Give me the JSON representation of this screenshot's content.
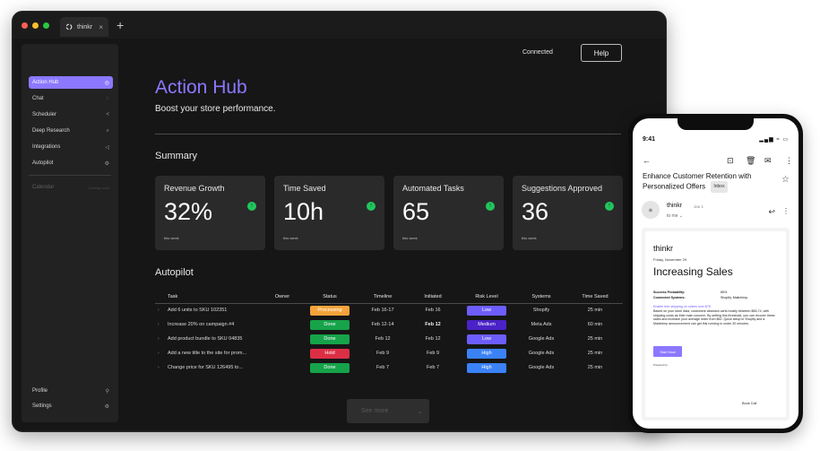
{
  "window": {
    "tab_title": "thinkr",
    "tab_close": "×",
    "new_tab": "+",
    "traffic_colors": [
      "#ff5f57",
      "#febc2e",
      "#28c840"
    ]
  },
  "sidebar": {
    "items": [
      {
        "label": "Action Hub",
        "icon": "target-icon",
        "glyph": "◎"
      },
      {
        "label": "Chat",
        "icon": "chat-icon",
        "glyph": "◌"
      },
      {
        "label": "Scheduler",
        "icon": "share-icon",
        "glyph": "<"
      },
      {
        "label": "Deep Research",
        "icon": "search-icon",
        "glyph": "⌕"
      },
      {
        "label": "Integrations",
        "icon": "megaphone-icon",
        "glyph": "◁"
      },
      {
        "label": "Autopilot",
        "icon": "settings-icon",
        "glyph": "⚙"
      }
    ],
    "calendar": {
      "label": "Calendar",
      "badge": "Coming soon"
    },
    "bottom": [
      {
        "label": "Profile",
        "icon": "user-icon",
        "glyph": "⚲"
      },
      {
        "label": "Settings",
        "icon": "gear-icon",
        "glyph": "⚙"
      }
    ]
  },
  "header": {
    "status": "Connected",
    "help_label": "Help"
  },
  "page": {
    "title": "Action Hub",
    "subtitle": "Boost your store performance."
  },
  "summary": {
    "title": "Summary",
    "cards": [
      {
        "title": "Revenue Growth",
        "value": "32%",
        "caption": "this week"
      },
      {
        "title": "Time Saved",
        "value": "10h",
        "caption": "this week"
      },
      {
        "title": "Automated Tasks",
        "value": "65",
        "caption": "this week"
      },
      {
        "title": "Suggestions Approved",
        "value": "36",
        "caption": "this week"
      }
    ]
  },
  "autopilot": {
    "title": "Autopilot",
    "columns": [
      "Task",
      "Owner",
      "Status",
      "Timeline",
      "Initiated",
      "Risk Level",
      "Systems",
      "Time Saved"
    ],
    "rows": [
      {
        "task": "Add 6 units to SKU 102351",
        "owner": "",
        "status": "Processing",
        "status_color": "#f5a33a",
        "timeline": "Feb 16-17",
        "initiated": "Feb 16",
        "initiated_bold": false,
        "risk": "Low",
        "risk_color": "#6d5dfc",
        "systems": "Shopify",
        "time_saved": "25 min"
      },
      {
        "task": "Increase 20% on campaign #4",
        "owner": "",
        "status": "Done",
        "status_color": "#16a34a",
        "timeline": "Feb 12-14",
        "initiated": "Feb 12",
        "initiated_bold": true,
        "risk": "Medium",
        "risk_color": "#4a22c7",
        "systems": "Meta Ads",
        "time_saved": "60 min"
      },
      {
        "task": "Add product bundle to SKU 04835",
        "owner": "",
        "status": "Done",
        "status_color": "#16a34a",
        "timeline": "Feb 12",
        "initiated": "Feb 12",
        "initiated_bold": false,
        "risk": "Low",
        "risk_color": "#6d5dfc",
        "systems": "Google Ads",
        "time_saved": "25 min"
      },
      {
        "task": "Add a new title to the site for prom...",
        "owner": "",
        "status": "Hold",
        "status_color": "#dc2f45",
        "timeline": "Feb 9",
        "initiated": "Feb 9",
        "initiated_bold": false,
        "risk": "High",
        "risk_color": "#3b82f6",
        "systems": "Google Ads",
        "time_saved": "25 min"
      },
      {
        "task": "Change price for SKU 126495 to...",
        "owner": "",
        "status": "Done",
        "status_color": "#16a34a",
        "timeline": "Feb 7",
        "initiated": "Feb 7",
        "initiated_bold": false,
        "risk": "High",
        "risk_color": "#3b82f6",
        "systems": "Google Ads",
        "time_saved": "25 min"
      }
    ],
    "see_more": "See more"
  },
  "phone": {
    "time": "9:41",
    "subject": "Enhance Customer Retention with Personalized Offers",
    "inbox_badge": "Inbox",
    "sender": "thinkr",
    "date": "Jan 1",
    "to": "to me",
    "email": {
      "brand": "thinkr",
      "date": "Friday, November 29",
      "heading": "Increasing Sales",
      "prob_label": "Success Probability:",
      "prob_value": "85%",
      "systems_label": "Connected Systems:",
      "systems_value": "Shopify, Mailchimp.",
      "link": "Enable free shipping on orders over $75",
      "body": "Based on your store data, customers abandon carts mostly between $65-74, with shipping costs as their main concern. By setting this threshold, you can recover these sales and increase your average order from $62. Quick setup in Shopify and a Mailchimp announcement can get this running in under 30 minutes.",
      "button": "Start Now",
      "powered": "Powered by",
      "book": "Book Call"
    }
  }
}
